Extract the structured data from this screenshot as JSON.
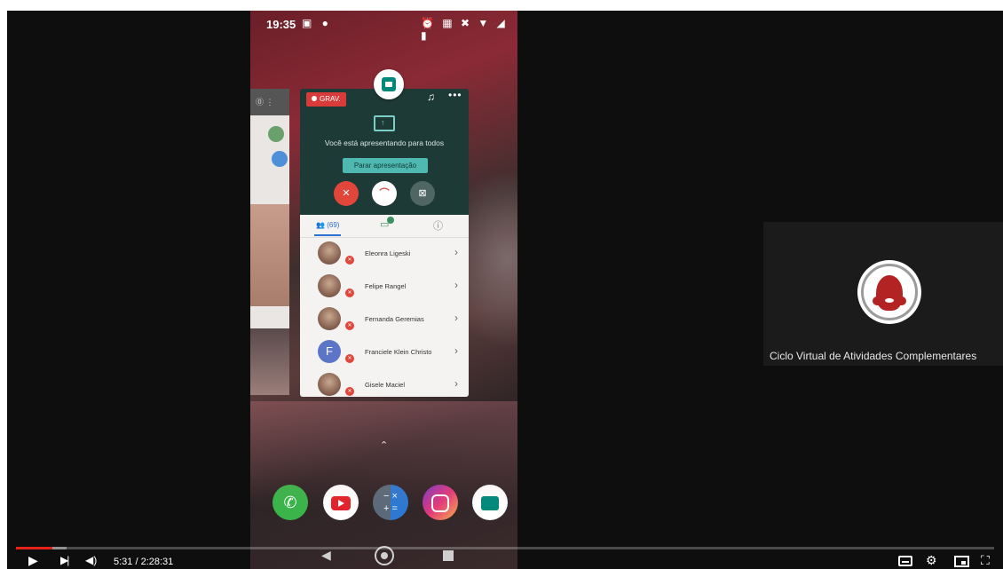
{
  "phone": {
    "status": {
      "time": "19:35",
      "left_icons": "▣ ●",
      "right_icons": "⏰ ▦ ✖ ▼ ◢ ▮"
    },
    "meet": {
      "recording_label": "GRAV.",
      "presenting_text": "Você está apresentando para todos",
      "stop_button": "Parar apresentação",
      "tabs": {
        "people": "(69)"
      },
      "participants": [
        {
          "name": "Eleonra Ligeski",
          "initial": ""
        },
        {
          "name": "Felipe Rangel",
          "initial": ""
        },
        {
          "name": "Fernanda Geremias",
          "initial": ""
        },
        {
          "name": "Franciele Klein Christo",
          "initial": "F"
        },
        {
          "name": "Gisele Maciel",
          "initial": ""
        }
      ]
    },
    "dock_apps": [
      "WhatsApp",
      "YouTube",
      "Calculator",
      "Instagram",
      "Meet"
    ]
  },
  "tile": {
    "name": "Ciclo Virtual de Atividades Complementares"
  },
  "player": {
    "time": "5:31 / 2:28:31",
    "progress": 0.037,
    "buffered": 0.052,
    "colors": {
      "played": "#e62117"
    }
  }
}
